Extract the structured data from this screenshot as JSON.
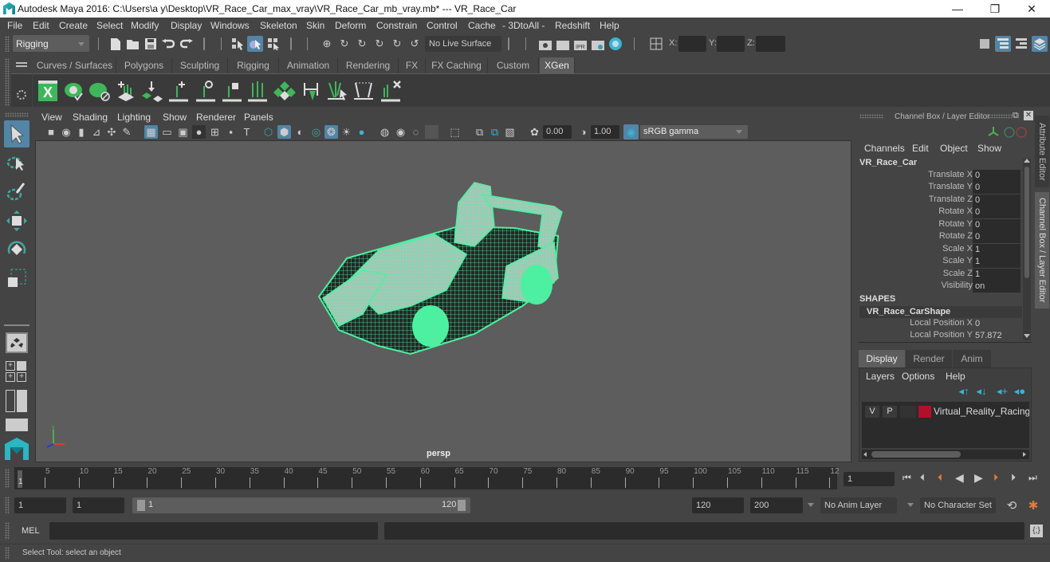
{
  "window": {
    "title": "Autodesk Maya 2016: C:\\Users\\a y\\Desktop\\VR_Race_Car_max_vray\\VR_Race_Car_mb_vray.mb*  ---  VR_Race_Car",
    "minimize": "—",
    "maximize": "❐",
    "close": "✕"
  },
  "menubar": [
    "File",
    "Edit",
    "Create",
    "Select",
    "Modify",
    "Display",
    "Windows",
    "Skeleton",
    "Skin",
    "Deform",
    "Constrain",
    "Control",
    "Cache",
    "- 3DtoAll -",
    "Redshift",
    "Help"
  ],
  "statusline": {
    "menuset": "Rigging",
    "live_surface": "No Live Surface",
    "x_label": "X:",
    "y_label": "Y:",
    "z_label": "Z:",
    "ipr_label": "IPR"
  },
  "shelf": {
    "tabs": [
      "Curves / Surfaces",
      "Polygons",
      "Sculpting",
      "Rigging",
      "Animation",
      "Rendering",
      "FX",
      "FX Caching",
      "Custom",
      "XGen"
    ],
    "active_tab": "XGen",
    "xgen_label": "X",
    "accent": "#3fb65a"
  },
  "viewport": {
    "menu": [
      "View",
      "Shading",
      "Lighting",
      "Show",
      "Renderer",
      "Panels"
    ],
    "exposure": "0.00",
    "gamma": "1.00",
    "color_space": "sRGB gamma",
    "camera_label": "persp",
    "axis": {
      "x": "x",
      "y": "y",
      "z": "z"
    },
    "wire_color": "#4df0a0"
  },
  "channel_box": {
    "title": "Channel Box / Layer Editor",
    "menu": [
      "Channels",
      "Edit",
      "Object",
      "Show"
    ],
    "object_name": "VR_Race_Car",
    "channels": [
      {
        "label": "Translate X",
        "value": "0"
      },
      {
        "label": "Translate Y",
        "value": "0"
      },
      {
        "label": "Translate Z",
        "value": "0"
      },
      {
        "label": "Rotate X",
        "value": "0"
      },
      {
        "label": "Rotate Y",
        "value": "0"
      },
      {
        "label": "Rotate Z",
        "value": "0"
      },
      {
        "label": "Scale X",
        "value": "1"
      },
      {
        "label": "Scale Y",
        "value": "1"
      },
      {
        "label": "Scale Z",
        "value": "1"
      },
      {
        "label": "Visibility",
        "value": "on"
      }
    ],
    "shapes_header": "SHAPES",
    "shape_name": "VR_Race_CarShape",
    "shape_channels": [
      {
        "label": "Local Position X",
        "value": "0"
      },
      {
        "label": "Local Position Y",
        "value": "57.872"
      }
    ]
  },
  "layer_editor": {
    "tabs": [
      "Display",
      "Render",
      "Anim"
    ],
    "active_tab": "Display",
    "menu": [
      "Layers",
      "Options",
      "Help"
    ],
    "layers": [
      {
        "v": "V",
        "p": "P",
        "color": "#b0102a",
        "name": "Virtual_Reality_Racing_G"
      }
    ]
  },
  "side_tabs": [
    "Attribute Editor",
    "Channel Box / Layer Editor"
  ],
  "timeline": {
    "ticks": [
      "5",
      "10",
      "15",
      "20",
      "25",
      "30",
      "35",
      "40",
      "45",
      "50",
      "55",
      "60",
      "65",
      "70",
      "75",
      "80",
      "85",
      "90",
      "95",
      "100",
      "105",
      "110",
      "115",
      "12"
    ],
    "current_frame_marker": "1",
    "current_frame": "1",
    "playback_buttons": [
      "go-to-start",
      "step-back-key",
      "step-back-frame",
      "play-backward",
      "play-forward",
      "step-forward-key",
      "step-forward-frame",
      "go-to-end"
    ]
  },
  "range": {
    "start": "1",
    "playback_start": "1",
    "slider_start": "1",
    "slider_end": "120",
    "playback_end": "120",
    "end": "200",
    "anim_layer": "No Anim Layer",
    "character_set": "No Character Set"
  },
  "command_line": {
    "label": "MEL",
    "value": "",
    "result": ""
  },
  "help_line": "Select Tool: select an object"
}
